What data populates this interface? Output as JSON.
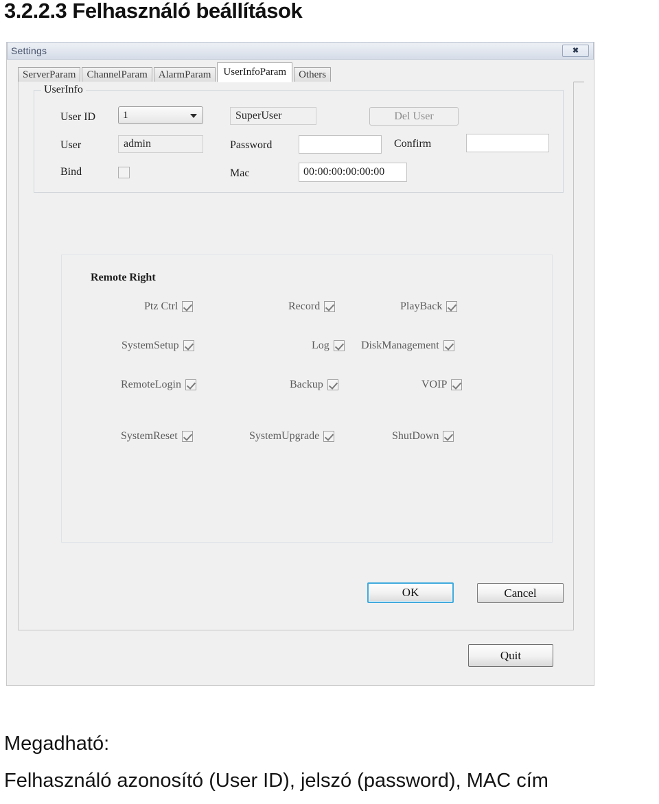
{
  "document": {
    "heading": "3.2.2.3 Felhasználó beállítások",
    "caption_line1": "Megadható:",
    "caption_line2": "Felhasználó azonosító (User ID), jelszó (password), MAC cím"
  },
  "window": {
    "title": "Settings",
    "close_glyph": "✖",
    "close_name": "close-button"
  },
  "tabs": [
    {
      "label": "ServerParam",
      "active": false
    },
    {
      "label": "ChannelParam",
      "active": false
    },
    {
      "label": "AlarmParam",
      "active": false
    },
    {
      "label": "UserInfoParam",
      "active": true
    },
    {
      "label": "Others",
      "active": false
    }
  ],
  "userinfo": {
    "legend": "UserInfo",
    "user_id_label": "User ID",
    "user_id_value": "1",
    "role_value": "SuperUser",
    "del_user_label": "Del User",
    "user_label": "User",
    "user_value": "admin",
    "password_label": "Password",
    "password_value": "",
    "confirm_label": "Confirm",
    "confirm_value": "",
    "bind_label": "Bind",
    "bind_checked": false,
    "mac_label": "Mac",
    "mac_value": "00:00:00:00:00:00"
  },
  "remote_right": {
    "title": "Remote Right",
    "rows": [
      [
        {
          "label": "Ptz Ctrl",
          "checked": true
        },
        {
          "label": "Record",
          "checked": true
        },
        {
          "label": "PlayBack",
          "checked": true
        }
      ],
      [
        {
          "label": "SystemSetup",
          "checked": true
        },
        {
          "label": "Log",
          "checked": true
        },
        {
          "label": "DiskManagement",
          "checked": true
        }
      ],
      [
        {
          "label": "RemoteLogin",
          "checked": true
        },
        {
          "label": "Backup",
          "checked": true
        },
        {
          "label": "VOIP",
          "checked": true
        }
      ],
      [
        {
          "label": "SystemReset",
          "checked": true
        },
        {
          "label": "SystemUpgrade",
          "checked": true
        },
        {
          "label": "ShutDown",
          "checked": true
        }
      ]
    ]
  },
  "actions": {
    "ok_label": "OK",
    "cancel_label": "Cancel",
    "quit_label": "Quit"
  },
  "colors": {
    "accent_focus": "#3fa9dd",
    "titlebar": "#e3e8f0",
    "dialog_bg": "#f0f0f0"
  }
}
